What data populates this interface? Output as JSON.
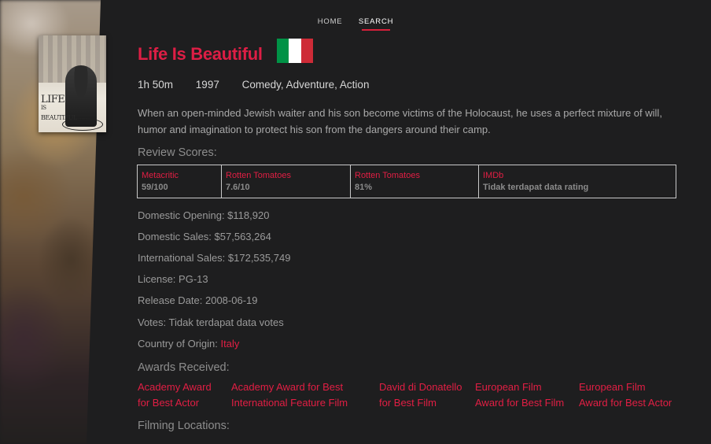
{
  "nav": {
    "items": [
      "HOME",
      "SEARCH"
    ],
    "active": "SEARCH"
  },
  "poster": {
    "title_main": "LIFE",
    "title_small": "IS",
    "title_rest": "BEAUTIFUL"
  },
  "movie": {
    "title": "Life Is Beautiful",
    "runtime": "1h 50m",
    "year": "1997",
    "genres": "Comedy, Adventure, Action",
    "description": "When an open-minded Jewish waiter and his son become victims of the Holocaust, he uses a perfect mixture of will, humor and imagination to protect his son from the dangers around their camp."
  },
  "flag": {
    "colors": [
      "#009246",
      "#ffffff",
      "#ce2b37"
    ]
  },
  "review": {
    "heading": "Review Scores:",
    "scores": [
      {
        "source": "Metacritic",
        "value": "59/100"
      },
      {
        "source": "Rotten Tomatoes",
        "value": "7.6/10"
      },
      {
        "source": "Rotten Tomatoes",
        "value": "81%"
      },
      {
        "source": "IMDb",
        "value": "Tidak terdapat data rating"
      }
    ]
  },
  "details": {
    "domestic_opening": "Domestic Opening: $118,920",
    "domestic_sales": "Domestic Sales: $57,563,264",
    "international_sales": "International Sales: $172,535,749",
    "license": "License: PG-13",
    "release_date": "Release Date: 2008-06-19",
    "votes": "Votes: Tidak terdapat data votes",
    "country_label": "Country of Origin: ",
    "country": "Italy"
  },
  "awards": {
    "heading": "Awards Received:",
    "items": [
      {
        "line1": "Academy Award",
        "line2": "for Best Actor"
      },
      {
        "line1": "Academy Award for Best",
        "line2": "International Feature Film"
      },
      {
        "line1": "David di Donatello",
        "line2": "for Best Film"
      },
      {
        "line1": "European Film",
        "line2": "Award for Best Film"
      },
      {
        "line1": "European Film",
        "line2": "Award for Best Actor"
      }
    ]
  },
  "filming": {
    "heading": "Filming Locations:"
  },
  "colors": {
    "accent": "#dd1e45",
    "background": "#1e1e1f"
  }
}
